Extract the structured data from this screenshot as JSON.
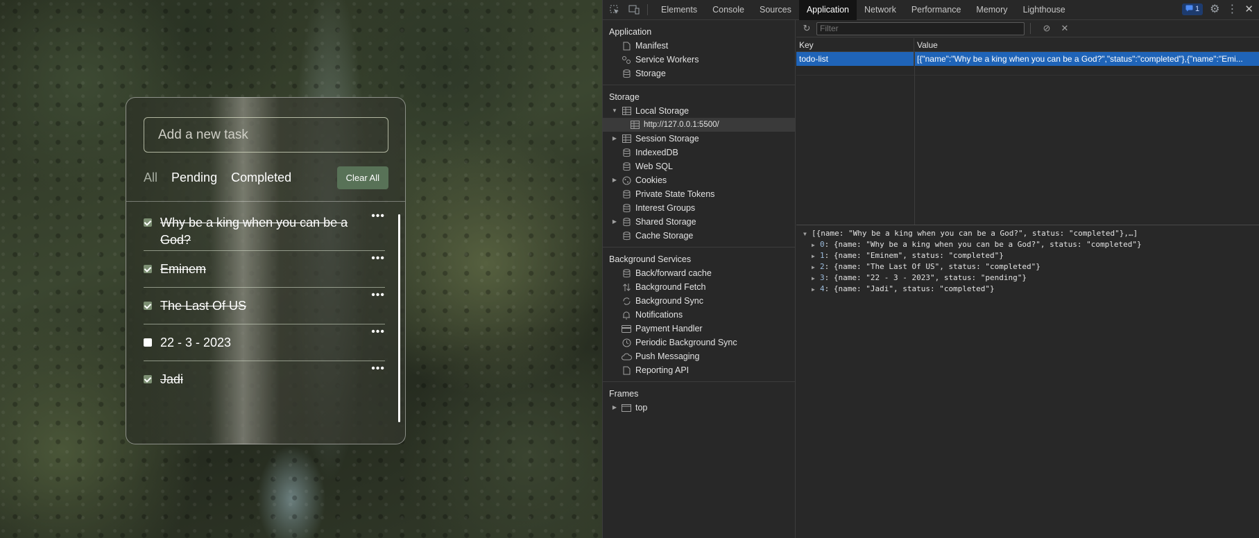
{
  "todo": {
    "input_placeholder": "Add a new task",
    "filters": [
      {
        "label": "All",
        "active": true
      },
      {
        "label": "Pending",
        "active": false
      },
      {
        "label": "Completed",
        "active": false
      }
    ],
    "clear_all_label": "Clear All",
    "tasks": [
      {
        "name": "Why be a king when you can be a God?",
        "completed": true
      },
      {
        "name": "Eminem",
        "completed": true
      },
      {
        "name": "The Last Of US",
        "completed": true
      },
      {
        "name": "22 - 3 - 2023",
        "completed": false
      },
      {
        "name": "Jadi",
        "completed": true
      }
    ],
    "menu_glyph": "•••"
  },
  "devtools": {
    "tabs": [
      "Elements",
      "Console",
      "Sources",
      "Application",
      "Network",
      "Performance",
      "Memory",
      "Lighthouse"
    ],
    "active_tab": "Application",
    "issues_count": "1",
    "sidebar": {
      "application": {
        "title": "Application",
        "items": [
          {
            "label": "Manifest",
            "icon": "file-icon"
          },
          {
            "label": "Service Workers",
            "icon": "gears-icon"
          },
          {
            "label": "Storage",
            "icon": "database-icon"
          }
        ]
      },
      "storage": {
        "title": "Storage",
        "items": [
          {
            "label": "Local Storage",
            "icon": "table-icon",
            "arrow": "down"
          },
          {
            "label": "http://127.0.0.1:5500/",
            "icon": "table-icon",
            "child": true,
            "selected": true
          },
          {
            "label": "Session Storage",
            "icon": "table-icon",
            "arrow": "right"
          },
          {
            "label": "IndexedDB",
            "icon": "database-icon"
          },
          {
            "label": "Web SQL",
            "icon": "database-icon"
          },
          {
            "label": "Cookies",
            "icon": "cookie-icon",
            "arrow": "right"
          },
          {
            "label": "Private State Tokens",
            "icon": "database-icon"
          },
          {
            "label": "Interest Groups",
            "icon": "database-icon"
          },
          {
            "label": "Shared Storage",
            "icon": "database-icon",
            "arrow": "right"
          },
          {
            "label": "Cache Storage",
            "icon": "database-icon"
          }
        ]
      },
      "background": {
        "title": "Background Services",
        "items": [
          {
            "label": "Back/forward cache",
            "icon": "database-icon"
          },
          {
            "label": "Background Fetch",
            "icon": "arrows-updown-icon"
          },
          {
            "label": "Background Sync",
            "icon": "sync-icon"
          },
          {
            "label": "Notifications",
            "icon": "bell-icon"
          },
          {
            "label": "Payment Handler",
            "icon": "card-icon"
          },
          {
            "label": "Periodic Background Sync",
            "icon": "clock-icon"
          },
          {
            "label": "Push Messaging",
            "icon": "cloud-icon"
          },
          {
            "label": "Reporting API",
            "icon": "file-icon"
          }
        ]
      },
      "frames": {
        "title": "Frames",
        "items": [
          {
            "label": "top",
            "icon": "frame-icon",
            "arrow": "right"
          }
        ]
      }
    },
    "filter_placeholder": "Filter",
    "table": {
      "key_header": "Key",
      "value_header": "Value",
      "rows": [
        {
          "key": "todo-list",
          "value": "[{\"name\":\"Why be a king when you can be a God?\",\"status\":\"completed\"},{\"name\":\"Emi..."
        }
      ]
    },
    "preview": {
      "root": "[{name: \"Why be a king when you can be a God?\", status: \"completed\"},…]",
      "children": [
        {
          "index": "0",
          "text": "{name: \"Why be a king when you can be a God?\", status: \"completed\"}"
        },
        {
          "index": "1",
          "text": "{name: \"Eminem\", status: \"completed\"}"
        },
        {
          "index": "2",
          "text": "{name: \"The Last Of US\", status: \"completed\"}"
        },
        {
          "index": "3",
          "text": "{name: \"22 - 3 - 2023\", status: \"pending\"}"
        },
        {
          "index": "4",
          "text": "{name: \"Jadi\", status: \"completed\"}"
        }
      ]
    }
  }
}
